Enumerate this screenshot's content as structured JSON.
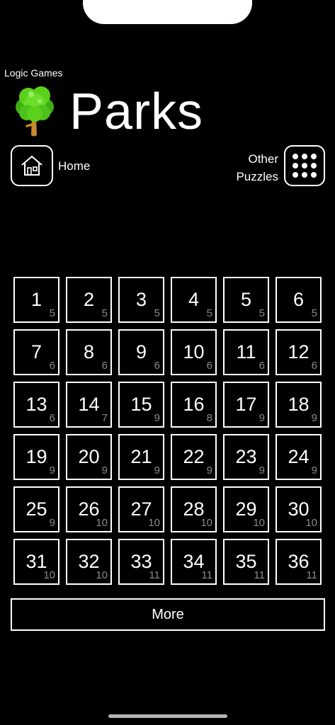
{
  "app": {
    "subtitle": "Logic Games",
    "title": "Parks"
  },
  "nav": {
    "home_label": "Home",
    "other_label_line1": "Other",
    "other_label_line2": "Puzzles"
  },
  "icons": {
    "tree": "tree-icon",
    "home": "home-icon",
    "grid": "grid-icon"
  },
  "colors": {
    "background": "#000000",
    "foreground": "#ffffff",
    "count_text": "#8a8a8a",
    "tree_leaf": "#5cd11c",
    "tree_trunk": "#c98a2b"
  },
  "puzzles": [
    {
      "number": "1",
      "size": "5"
    },
    {
      "number": "2",
      "size": "5"
    },
    {
      "number": "3",
      "size": "5"
    },
    {
      "number": "4",
      "size": "5"
    },
    {
      "number": "5",
      "size": "5"
    },
    {
      "number": "6",
      "size": "5"
    },
    {
      "number": "7",
      "size": "6"
    },
    {
      "number": "8",
      "size": "6"
    },
    {
      "number": "9",
      "size": "6"
    },
    {
      "number": "10",
      "size": "6"
    },
    {
      "number": "11",
      "size": "6"
    },
    {
      "number": "12",
      "size": "6"
    },
    {
      "number": "13",
      "size": "6"
    },
    {
      "number": "14",
      "size": "7"
    },
    {
      "number": "15",
      "size": "9"
    },
    {
      "number": "16",
      "size": "8"
    },
    {
      "number": "17",
      "size": "9"
    },
    {
      "number": "18",
      "size": "9"
    },
    {
      "number": "19",
      "size": "9"
    },
    {
      "number": "20",
      "size": "9"
    },
    {
      "number": "21",
      "size": "9"
    },
    {
      "number": "22",
      "size": "9"
    },
    {
      "number": "23",
      "size": "9"
    },
    {
      "number": "24",
      "size": "9"
    },
    {
      "number": "25",
      "size": "9"
    },
    {
      "number": "26",
      "size": "10"
    },
    {
      "number": "27",
      "size": "10"
    },
    {
      "number": "28",
      "size": "10"
    },
    {
      "number": "29",
      "size": "10"
    },
    {
      "number": "30",
      "size": "10"
    },
    {
      "number": "31",
      "size": "10"
    },
    {
      "number": "32",
      "size": "10"
    },
    {
      "number": "33",
      "size": "11"
    },
    {
      "number": "34",
      "size": "11"
    },
    {
      "number": "35",
      "size": "11"
    },
    {
      "number": "36",
      "size": "11"
    }
  ],
  "more_label": "More"
}
